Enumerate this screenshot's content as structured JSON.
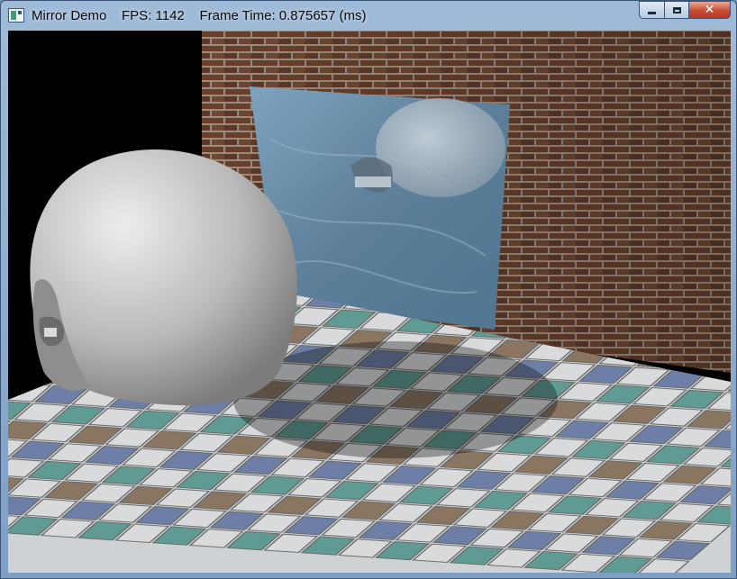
{
  "window": {
    "title": "Mirror Demo",
    "fps_label": "FPS: 1142",
    "frame_time_label": "Frame Time: 0.875657 (ms)"
  },
  "caption_buttons": {
    "minimize_icon": "minimize-icon",
    "maximize_icon": "maximize-icon",
    "close_icon": "close-icon",
    "close_glyph": "✕"
  },
  "scene": {
    "objects": [
      "brick-wall",
      "mirror",
      "skull",
      "skull-reflection",
      "tiled-floor",
      "skull-shadow"
    ],
    "colors": {
      "brick": "#7a4a32",
      "mortar": "#b9a99a",
      "mirror": "#6f93ad",
      "skull": "#c8c8c8",
      "tile_white": "#d8dadc",
      "tile_teal": "#5f9a93",
      "tile_blue": "#6d7fa6",
      "tile_brown": "#8a7560"
    }
  }
}
